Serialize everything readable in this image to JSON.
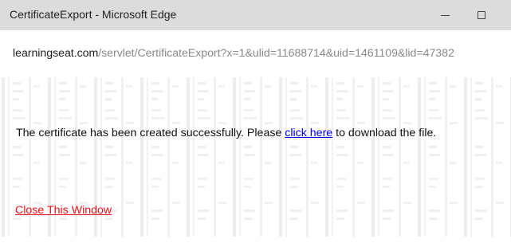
{
  "window": {
    "title": "CertificateExport - Microsoft Edge"
  },
  "titlebar_icons": {
    "minimize": "minimize-icon",
    "maximize": "maximize-icon"
  },
  "address": {
    "host": "learningseat.com",
    "path": "/servlet/CertificateExport?x=1&ulid=11688714&uid=1461109&lid=47382"
  },
  "content": {
    "message_before": "The certificate has been created successfully. Please ",
    "link_text": "click here",
    "message_after": " to download the file.",
    "close_link": "Close This Window"
  },
  "colors": {
    "titlebar_bg": "#dcdcdc",
    "link": "#0000ee",
    "close_link": "#e8141b",
    "url_path": "#8a8a8a"
  }
}
